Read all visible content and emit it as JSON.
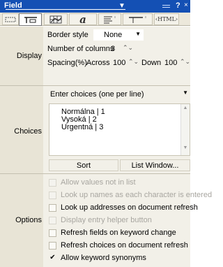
{
  "titlebar": {
    "title": "Field",
    "menu_arrow": "▼",
    "help": "?",
    "close": "×"
  },
  "tabs": [
    {
      "name": "text-style-tab",
      "label": ""
    },
    {
      "name": "field-tab",
      "label": "",
      "active": true
    },
    {
      "name": "grid-tab",
      "label": ""
    },
    {
      "name": "font-tab",
      "label": "a"
    },
    {
      "name": "paragraph-tab",
      "label": ""
    },
    {
      "name": "ruler-tab",
      "label": ""
    },
    {
      "name": "html-tab",
      "label": "‹HTML›"
    }
  ],
  "display": {
    "section_label": "Display",
    "border_style_label": "Border style",
    "border_style_value": "None",
    "columns_label": "Number of columns",
    "columns_value": "3",
    "spacing_label": "Spacing(%)",
    "across_label": "Across",
    "across_value": "100",
    "down_label": "Down",
    "down_value": "100"
  },
  "choices": {
    "section_label": "Choices",
    "source_value": "Enter choices (one per line)",
    "lines": [
      "Normálna | 1",
      "Vysoká | 2",
      "Urgentná | 3"
    ],
    "sort_button": "Sort",
    "list_window_button": "List Window..."
  },
  "options": {
    "section_label": "Options",
    "items": [
      {
        "name": "allow-values-not-in-list",
        "label": "Allow values not in list",
        "checked": false,
        "enabled": false
      },
      {
        "name": "look-up-names-each-char",
        "label": "Look up names as each character is entered",
        "checked": false,
        "enabled": false
      },
      {
        "name": "look-up-addresses",
        "label": "Look up addresses on document refresh",
        "checked": false,
        "enabled": true
      },
      {
        "name": "display-entry-helper",
        "label": "Display entry helper button",
        "checked": false,
        "enabled": false
      },
      {
        "name": "refresh-fields-keyword-change",
        "label": "Refresh fields on keyword change",
        "checked": false,
        "enabled": true
      },
      {
        "name": "refresh-choices-document-refresh",
        "label": "Refresh choices on document refresh",
        "checked": false,
        "enabled": true
      },
      {
        "name": "allow-keyword-synonyms",
        "label": "Allow keyword synonyms",
        "checked": true,
        "enabled": true
      }
    ],
    "check_mark": "✔"
  },
  "colors": {
    "titlebar": "#1450b4",
    "panel": "#e8e4d6",
    "tabstrip": "#ece8db"
  }
}
